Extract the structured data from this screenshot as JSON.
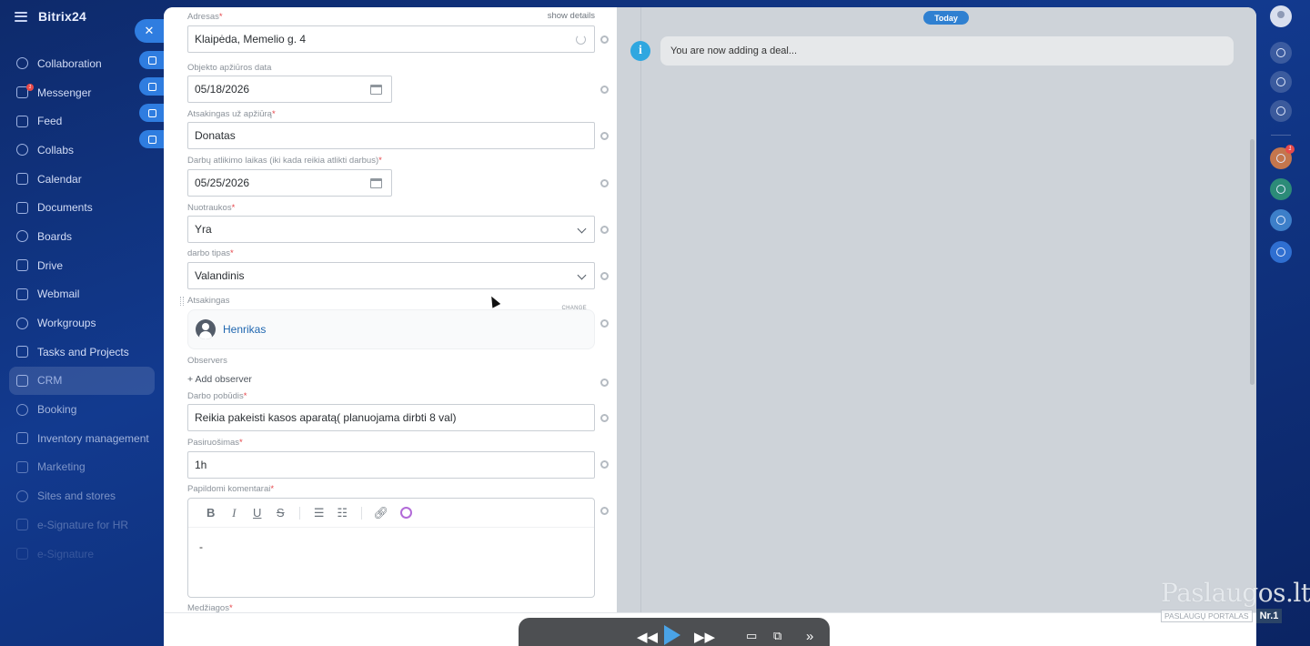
{
  "app": {
    "name": "Bitrix24"
  },
  "sidebar": {
    "items": [
      {
        "label": "Collaboration",
        "icon": "collaboration-icon"
      },
      {
        "label": "Messenger",
        "icon": "messenger-icon",
        "badge": "1"
      },
      {
        "label": "Feed",
        "icon": "feed-icon"
      },
      {
        "label": "Collabs",
        "icon": "collabs-icon"
      },
      {
        "label": "Calendar",
        "icon": "calendar-icon"
      },
      {
        "label": "Documents",
        "icon": "documents-icon"
      },
      {
        "label": "Boards",
        "icon": "boards-icon"
      },
      {
        "label": "Drive",
        "icon": "drive-icon"
      },
      {
        "label": "Webmail",
        "icon": "webmail-icon"
      },
      {
        "label": "Workgroups",
        "icon": "workgroups-icon"
      },
      {
        "label": "Tasks and Projects",
        "icon": "tasks-icon"
      },
      {
        "label": "CRM",
        "icon": "crm-icon",
        "active": true
      },
      {
        "label": "Booking",
        "icon": "booking-icon"
      },
      {
        "label": "Inventory management",
        "icon": "inventory-icon"
      },
      {
        "label": "Marketing",
        "icon": "marketing-icon"
      },
      {
        "label": "Sites and stores",
        "icon": "sites-icon"
      },
      {
        "label": "e-Signature for HR",
        "icon": "esignature-hr-icon"
      },
      {
        "label": "e-Signature",
        "icon": "esignature-icon"
      }
    ]
  },
  "form": {
    "address": {
      "label": "Adresas",
      "value": "Klaipėda, Memelio g. 4",
      "show_details": "show details"
    },
    "inspection_date": {
      "label": "Objekto apžiūros data",
      "value": "05/18/2026"
    },
    "inspection_responsible": {
      "label": "Atsakingas už apžiūrą",
      "value": "Donatas"
    },
    "deadline": {
      "label": "Darbų atlikimo laikas (iki kada reikia atlikti darbus)",
      "value": "05/25/2026"
    },
    "photos": {
      "label": "Nuotraukos",
      "value": "Yra"
    },
    "work_type": {
      "label": "darbo tipas",
      "value": "Valandinis"
    },
    "responsible": {
      "label": "Atsakingas",
      "name": "Henrikas",
      "change": "CHANGE"
    },
    "observers": {
      "label": "Observers",
      "add": "+ Add observer"
    },
    "work_nature": {
      "label": "Darbo pobūdis",
      "value": "Reikia pakeisti kasos aparatą( planuojama dirbti 8 val)"
    },
    "preparation": {
      "label": "Pasiruošimas",
      "value": "1h"
    },
    "comments": {
      "label": "Papildomi komentarai",
      "value": "-"
    },
    "materials": {
      "label": "Medžiagos"
    },
    "required_mark": "*"
  },
  "timeline": {
    "today": "Today",
    "message": "You are now adding a deal..."
  },
  "right_rail": {
    "notification_badge": "1"
  },
  "watermark": {
    "main": "Paslaugos.lt",
    "sub": "PASLAUGŲ PORTALAS",
    "rank": "Nr.1"
  },
  "colors": {
    "accent": "#2f80d1",
    "required": "#e5454a",
    "sidebar_bg": "#123a8f",
    "timeline_bg": "#ced3d9"
  }
}
